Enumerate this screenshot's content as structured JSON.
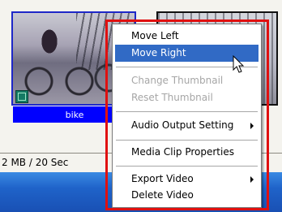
{
  "clips": [
    {
      "name": "bike",
      "selected": true,
      "icon": "film-clip-icon"
    },
    {
      "name": "",
      "selected": false
    }
  ],
  "status": {
    "text": "2 MB / 20 Sec"
  },
  "menu": {
    "items": [
      {
        "label": "Move Left",
        "state": "normal"
      },
      {
        "label": "Move Right",
        "state": "hover"
      },
      {
        "label": "Change Thumbnail",
        "state": "disabled"
      },
      {
        "label": "Reset Thumbnail",
        "state": "disabled"
      },
      {
        "label": "Audio Output Setting",
        "state": "normal",
        "submenu": true
      },
      {
        "label": "Media Clip Properties",
        "state": "normal"
      },
      {
        "label": "Export Video",
        "state": "normal",
        "submenu": true
      },
      {
        "label": "Delete Video",
        "state": "normal"
      }
    ]
  },
  "colors": {
    "selection_blue": "#0000ff",
    "menu_hover": "#316ac5",
    "highlight_box": "#e01010",
    "taskbar": "#1f63c9"
  }
}
